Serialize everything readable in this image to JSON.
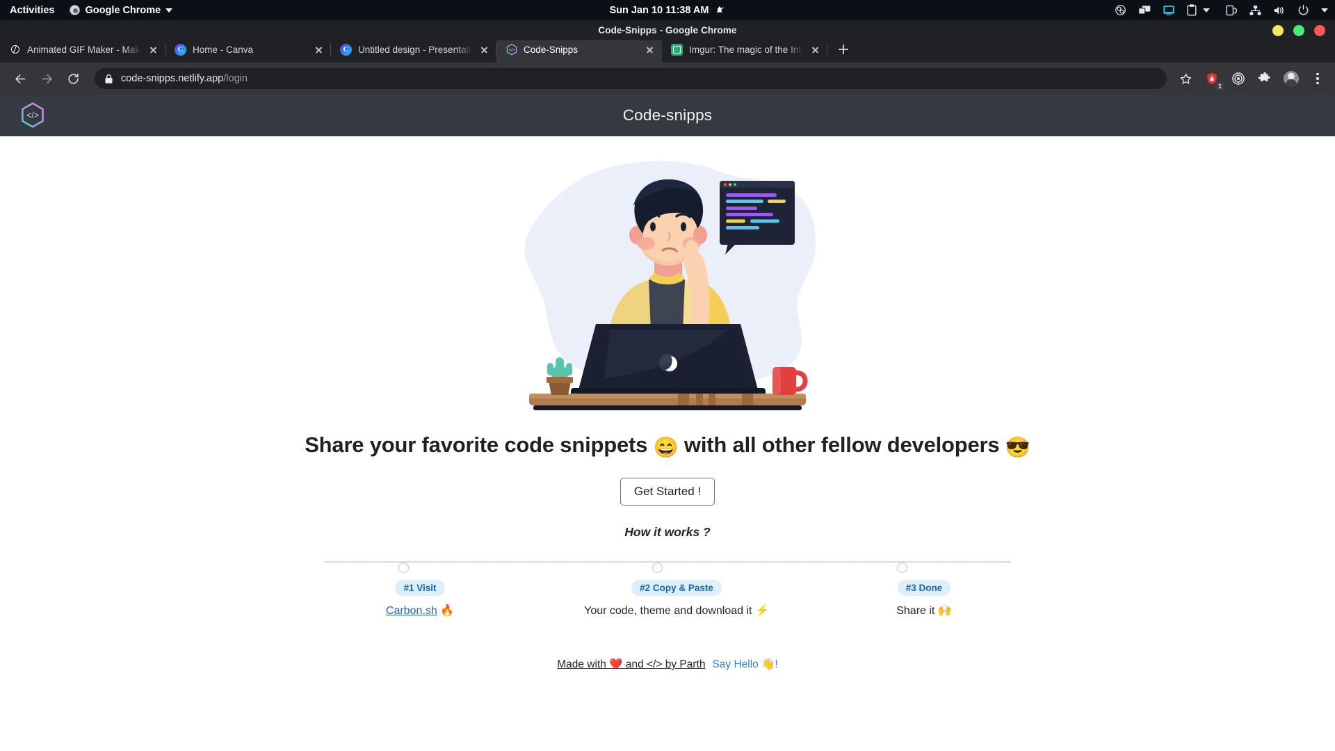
{
  "os_bar": {
    "activities": "Activities",
    "app_menu": "Google Chrome",
    "clock": "Sun Jan 10  11:38 AM",
    "tray_icons": [
      "notifications-muted-icon",
      "obs-icon",
      "screencast-icon",
      "display-icon",
      "clipboard-icon",
      "tray-chevron-icon",
      "network-device-icon",
      "network-icon",
      "volume-icon",
      "power-icon",
      "system-chevron-icon"
    ]
  },
  "window": {
    "title": "Code-Snipps - Google Chrome",
    "controls": [
      "minimize",
      "maximize",
      "close"
    ],
    "control_colors": [
      "#f0e95a",
      "#4ae87a",
      "#fb5a52"
    ]
  },
  "tabs": [
    {
      "title": "Animated GIF Maker - Make GI",
      "favicon": "globe-icon",
      "active": false
    },
    {
      "title": "Home - Canva",
      "favicon": "canva-icon",
      "active": false
    },
    {
      "title": "Untitled design - Presentatio",
      "favicon": "canva-icon",
      "active": false
    },
    {
      "title": "Code-Snipps",
      "favicon": "code-snipps-icon",
      "active": true
    },
    {
      "title": "Imgur: The magic of the Intern",
      "favicon": "imgur-icon",
      "active": false
    }
  ],
  "toolbar": {
    "back": "back-arrow",
    "forward": "forward-arrow",
    "reload": "reload-icon",
    "url_host": "code-snipps.netlify.app",
    "url_path": "/login",
    "lock": "lock-icon",
    "bookmark": "star-icon",
    "extension_badge": "1",
    "icons": [
      "shield-extension-icon",
      "target-extension-icon",
      "puzzle-extensions-icon",
      "profile-avatar",
      "three-dot-menu"
    ]
  },
  "app": {
    "logo": "code-brackets-hexagon-logo",
    "title": "Code-snipps",
    "headline_before": "Share your favorite code snippets ",
    "headline_emoji_1": "😄",
    "headline_middle": " with all other fellow developers ",
    "headline_emoji_2": "😎",
    "cta_label": "Get Started !",
    "how_it_works": "How it works ?"
  },
  "steps": [
    {
      "badge": "#1 Visit",
      "link": "Carbon.sh",
      "emoji": "🔥",
      "desc": ""
    },
    {
      "badge": "#2 Copy & Paste",
      "link": "",
      "emoji": "⚡",
      "desc": "Your code, theme and download it"
    },
    {
      "badge": "#3 Done",
      "link": "",
      "emoji": "🙌",
      "desc": "Share it"
    }
  ],
  "footer": {
    "made_with_prefix": "Made with ",
    "made_with_heart": "❤️",
    "made_with_mid": " and </> by ",
    "made_with_author": "Parth",
    "say_hello": "Say Hello 👋!"
  },
  "colors": {
    "app_header_bg": "#343a40",
    "badge_bg": "#ddeefc",
    "badge_text": "#1167b1",
    "link_blue": "#2563d4",
    "timeline": "#d3dcea",
    "illustration_blob": "#eaeffa"
  }
}
